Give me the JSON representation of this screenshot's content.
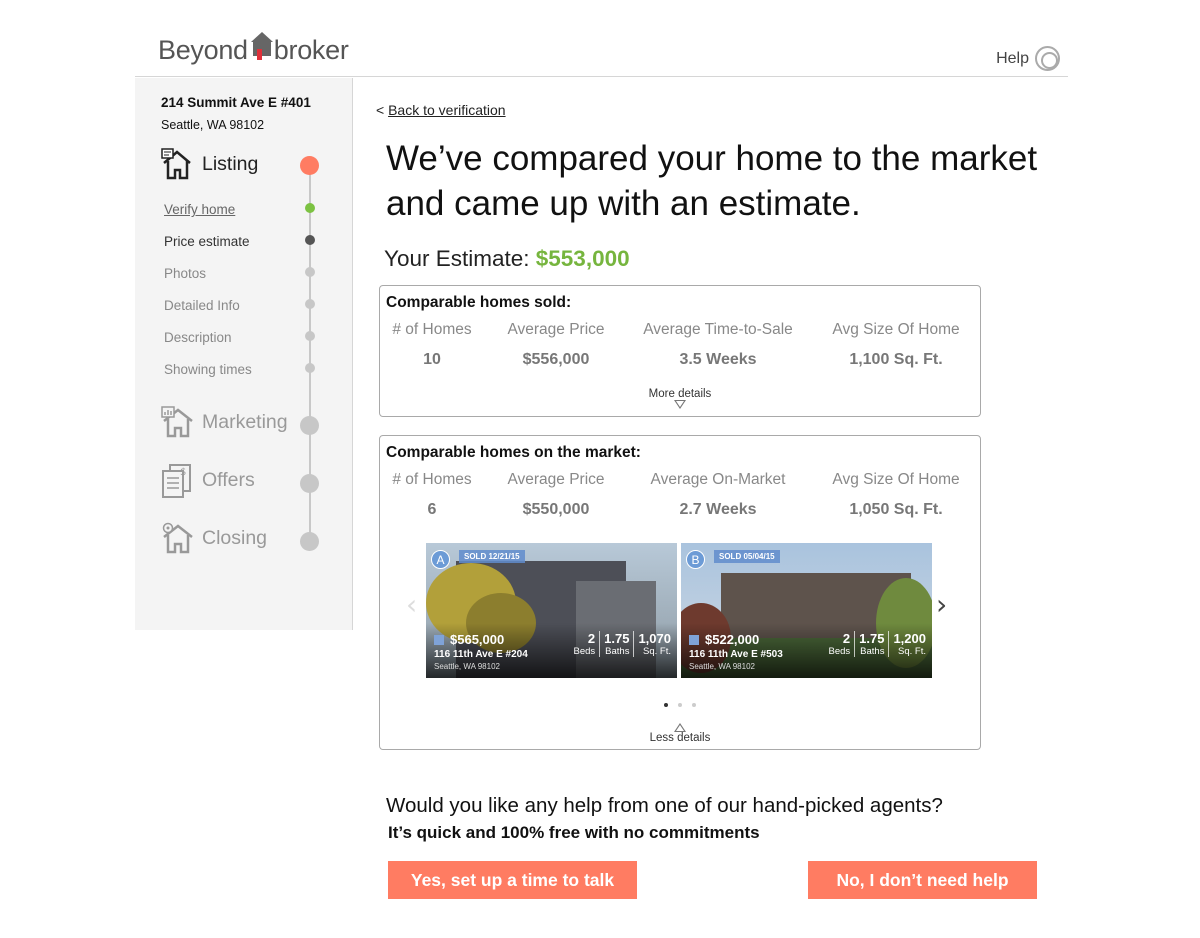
{
  "header": {
    "logo_left": "Beyond",
    "logo_right": "broker",
    "help_label": "Help"
  },
  "sidebar": {
    "address_line1": "214 Summit Ave E #401",
    "address_line2": "Seattle, WA 98102",
    "stages": [
      {
        "label": "Listing",
        "icon": "house-listing-icon",
        "state": "active"
      },
      {
        "label": "Marketing",
        "icon": "house-chart-icon",
        "state": "inactive"
      },
      {
        "label": "Offers",
        "icon": "documents-dollar-icon",
        "state": "inactive"
      },
      {
        "label": "Closing",
        "icon": "house-gear-icon",
        "state": "inactive"
      }
    ],
    "substeps": [
      {
        "label": "Verify home",
        "state": "done"
      },
      {
        "label": "Price estimate",
        "state": "current"
      },
      {
        "label": "Photos",
        "state": "todo"
      },
      {
        "label": "Detailed Info",
        "state": "todo"
      },
      {
        "label": "Description",
        "state": "todo"
      },
      {
        "label": "Showing times",
        "state": "todo"
      }
    ]
  },
  "main": {
    "back_prefix": "<",
    "back_label": "Back to verification",
    "headline": "We’ve compared your home to the market and came up with an estimate.",
    "estimate_label": "Your Estimate:",
    "estimate_value": "$553,000",
    "sold_card": {
      "title": "Comparable homes sold:",
      "headers": [
        "# of Homes",
        "Average Price",
        "Average Time-to-Sale",
        "Avg Size Of Home"
      ],
      "values": [
        "10",
        "$556,000",
        "3.5 Weeks",
        "1,100 Sq. Ft."
      ],
      "toggle_label": "More details"
    },
    "market_card": {
      "title": "Comparable homes on the market:",
      "headers": [
        "# of Homes",
        "Average Price",
        "Average On-Market",
        "Avg Size Of Home"
      ],
      "values": [
        "6",
        "$550,000",
        "2.7 Weeks",
        "1,050 Sq. Ft."
      ],
      "toggle_label": "Less details",
      "listings": [
        {
          "pin": "A",
          "sold": "SOLD 12/21/15",
          "price": "$565,000",
          "street": "116 11th Ave E #204",
          "city": "Seattle, WA 98102",
          "beds": "2",
          "beds_label": "Beds",
          "baths": "1.75",
          "baths_label": "Baths",
          "sqft": "1,070",
          "sqft_label": "Sq. Ft."
        },
        {
          "pin": "B",
          "sold": "SOLD 05/04/15",
          "price": "$522,000",
          "street": "116 11th Ave E #503",
          "city": "Seattle, WA 98102",
          "beds": "2",
          "beds_label": "Beds",
          "baths": "1.75",
          "baths_label": "Baths",
          "sqft": "1,200",
          "sqft_label": "Sq. Ft."
        }
      ],
      "carousel_pages": 3,
      "carousel_current": 1
    },
    "help_question": "Would you like any help from one of our hand-picked agents?",
    "help_subtext": "It’s quick and 100% free with no commitments",
    "yes_button": "Yes, set up a time to talk",
    "no_button": "No, I don’t need help"
  },
  "colors": {
    "accent": "#ff7c62",
    "estimate_green": "#76b53e",
    "done_green": "#7cc242"
  }
}
